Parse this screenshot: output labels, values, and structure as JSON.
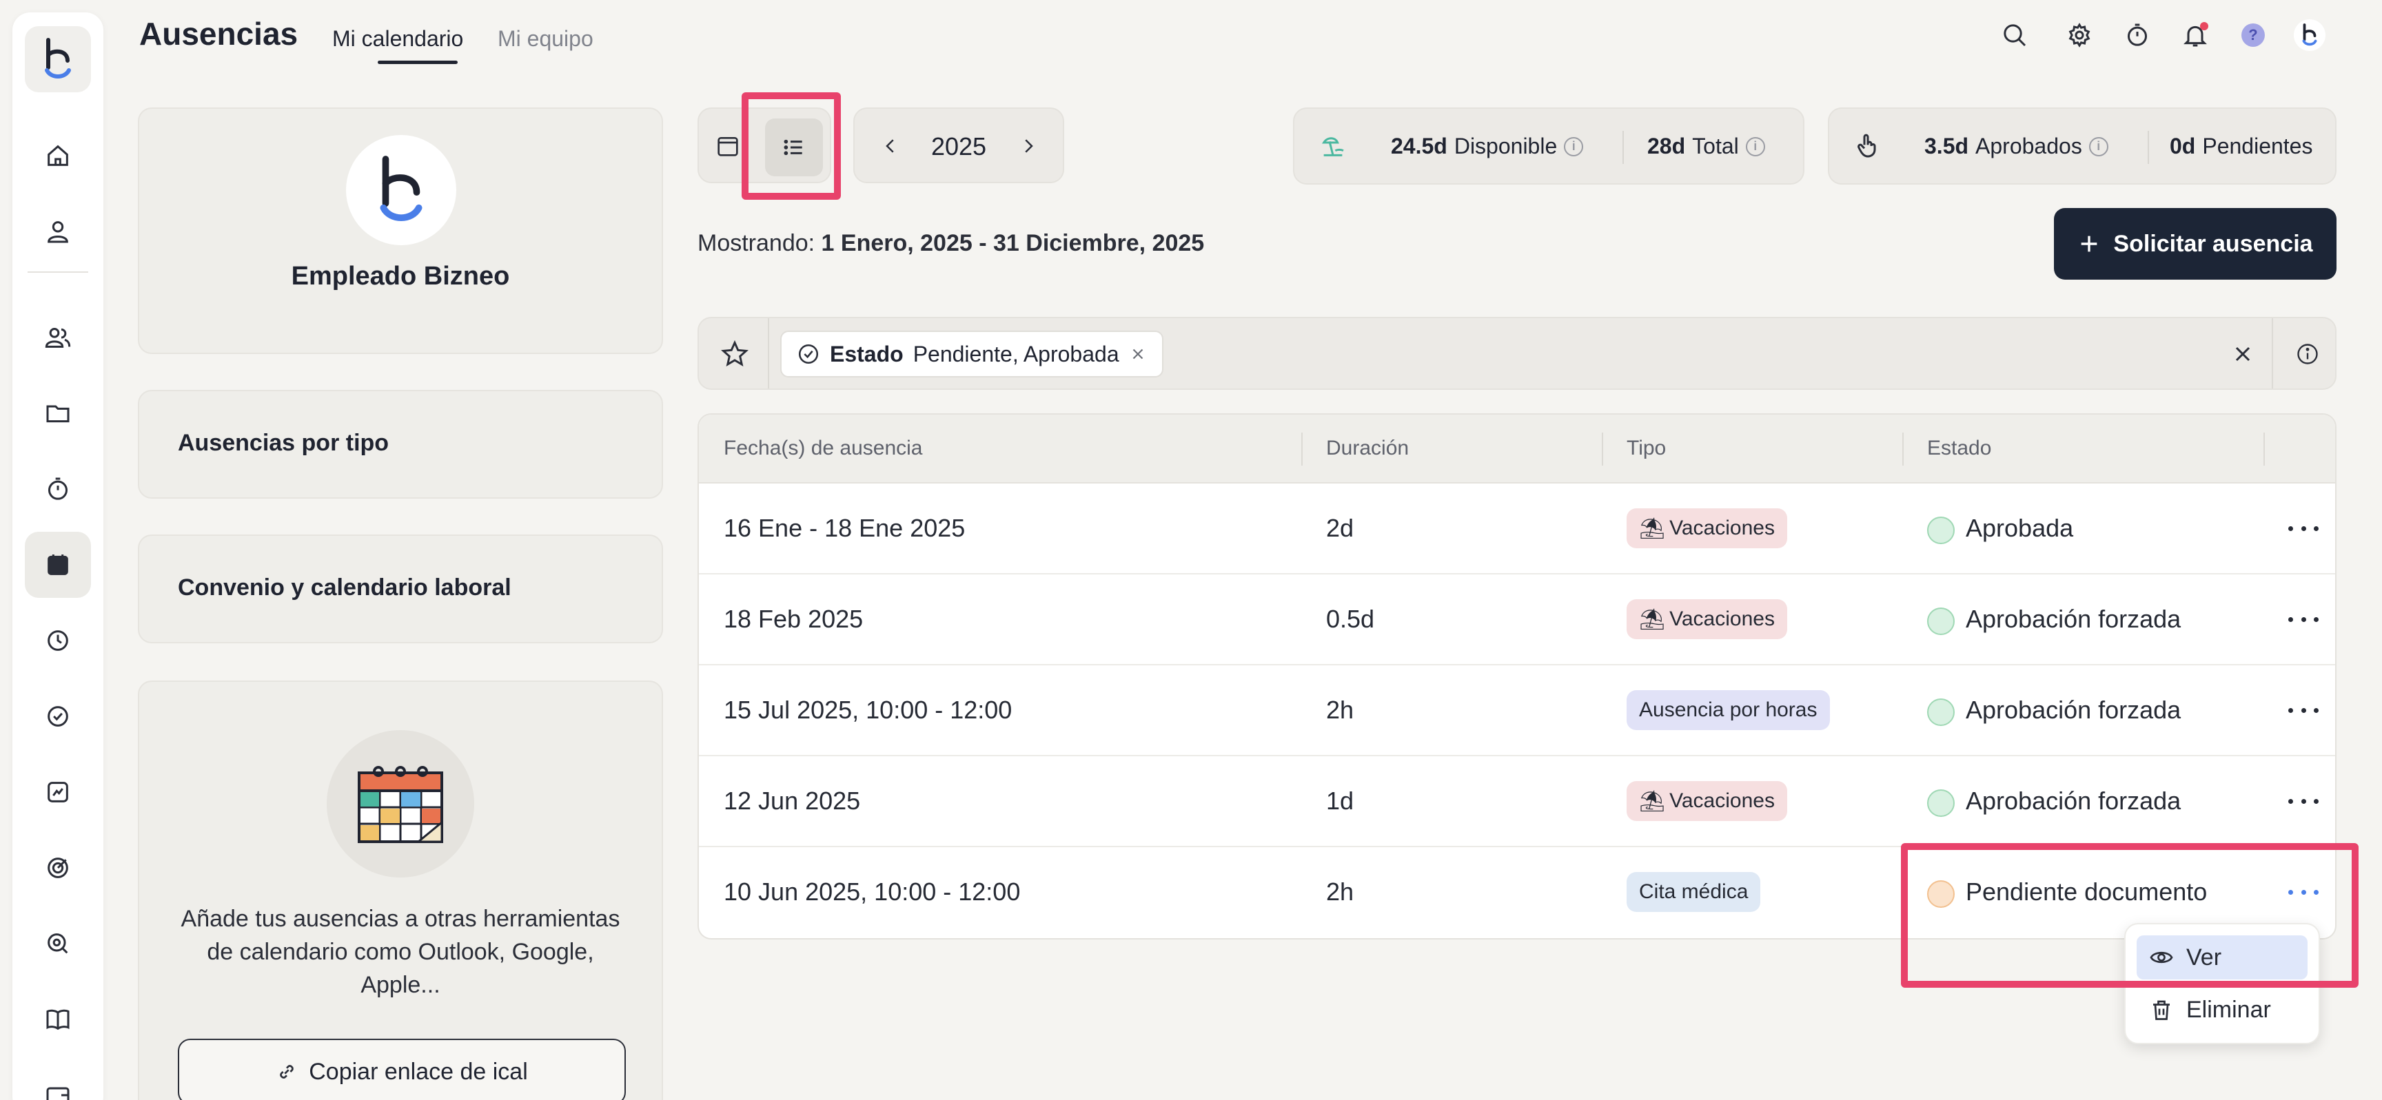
{
  "app": {
    "title": "Ausencias",
    "tabs": [
      {
        "label": "Mi calendario",
        "active": true
      },
      {
        "label": "Mi equipo",
        "active": false
      }
    ]
  },
  "header_icons": [
    "search-icon",
    "gear-icon",
    "stopwatch-icon",
    "bell-icon",
    "help-icon",
    "user-avatar"
  ],
  "help_label": "?",
  "sidebar": {
    "items": [
      "home-icon",
      "user-icon",
      "team-icon",
      "folder-icon",
      "timer-icon",
      "calendar-icon",
      "clock-icon",
      "check-icon",
      "chart-icon",
      "target-icon",
      "search-doc-icon",
      "book-icon",
      "wallet-icon"
    ],
    "active": "calendar-icon"
  },
  "profile": {
    "name": "Empleado Bizneo"
  },
  "cards": {
    "by_type": "Ausencias por tipo",
    "agreement": "Convenio y calendario laboral",
    "ical_text": "Añade tus ausencias a otras herramientas de calendario como Outlook, Google, Apple...",
    "ical_button": "Copiar enlace de ical"
  },
  "year_nav": {
    "year": "2025"
  },
  "stats": {
    "available_value": "24.5d",
    "available_label": "Disponible",
    "total_value": "28d",
    "total_label": "Total",
    "approved_value": "3.5d",
    "approved_label": "Aprobados",
    "pending_value": "0d",
    "pending_label": "Pendientes"
  },
  "info_glyph": "i",
  "showing": {
    "prefix": "Mostrando:",
    "range": "1 Enero, 2025 - 31 Diciembre, 2025"
  },
  "request_button": "Solicitar ausencia",
  "filter": {
    "field": "Estado",
    "values": "Pendiente, Aprobada"
  },
  "table": {
    "headers": [
      "Fecha(s) de ausencia",
      "Duración",
      "Tipo",
      "Estado"
    ],
    "rows": [
      {
        "date": "16 Ene - 18 Ene 2025",
        "duration": "2d",
        "type": "Vacaciones",
        "type_kind": "vac",
        "status": "Aprobada",
        "status_color": "green"
      },
      {
        "date": "18 Feb 2025",
        "duration": "0.5d",
        "type": "Vacaciones",
        "type_kind": "vac",
        "status": "Aprobación forzada",
        "status_color": "green"
      },
      {
        "date": "15 Jul 2025, 10:00 - 12:00",
        "duration": "2h",
        "type": "Ausencia por horas",
        "type_kind": "hrs",
        "status": "Aprobación forzada",
        "status_color": "green"
      },
      {
        "date": "12 Jun 2025",
        "duration": "1d",
        "type": "Vacaciones",
        "type_kind": "vac",
        "status": "Aprobación forzada",
        "status_color": "green"
      },
      {
        "date": "10 Jun 2025, 10:00 - 12:00",
        "duration": "2h",
        "type": "Cita médica",
        "type_kind": "med",
        "status": "Pendiente documento",
        "status_color": "orange"
      }
    ]
  },
  "context_menu": {
    "items": [
      "Ver",
      "Eliminar"
    ],
    "active": "Ver"
  },
  "colors": {
    "accent_highlight": "#e8426b",
    "primary_button": "#1c2536",
    "approved": "#9fd8b4",
    "pending": "#f2c08f"
  }
}
